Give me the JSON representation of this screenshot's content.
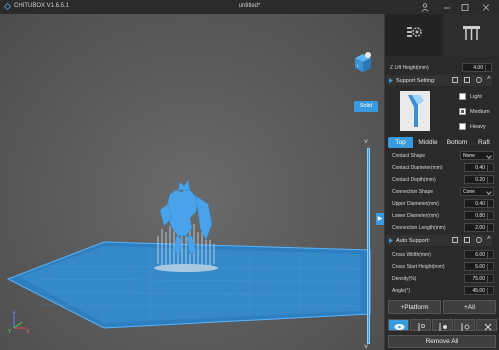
{
  "titlebar": {
    "app_name": "CHITUBOX V1.6.5.1",
    "doc_title": "untitled*",
    "user_icon": "user-icon",
    "minimize_icon": "minimize-icon",
    "maximize_icon": "maximize-icon",
    "close_icon": "close-icon"
  },
  "viewport": {
    "render_mode": "Solid",
    "axis_x": "X",
    "axis_y": "Y",
    "axis_z": "Z"
  },
  "panel": {
    "tabs": [
      {
        "label": "print-settings-tab",
        "icon": "gear-icon"
      },
      {
        "label": "support-tab",
        "icon": "support-icon"
      }
    ],
    "z_lift": {
      "label": "Z Lift Height(mm)",
      "value": "4.00"
    },
    "support_setting": {
      "label": "Support Setting:"
    },
    "density_options": [
      {
        "label": "Light",
        "checked": false
      },
      {
        "label": "Medium",
        "checked": true
      },
      {
        "label": "Heavy",
        "checked": false
      }
    ],
    "sub_tabs": [
      "Top",
      "Middle",
      "Bottom",
      "Raft"
    ],
    "active_sub_tab": "Top",
    "top_fields": [
      {
        "label": "Contact Shape",
        "value": "None",
        "type": "dropdown"
      },
      {
        "label": "Contact Diameter(mm)",
        "value": "0.40"
      },
      {
        "label": "Contact Depth(mm)",
        "value": "0.20"
      },
      {
        "label": "Connection Shape",
        "value": "Cone",
        "type": "dropdown"
      },
      {
        "label": "Upper Diameter(mm)",
        "value": "0.40"
      },
      {
        "label": "Lower Diameter(mm)",
        "value": "0.80"
      },
      {
        "label": "Connection Length(mm)",
        "value": "2.00"
      }
    ],
    "auto_support": {
      "label": "Auto Support:"
    },
    "auto_fields": [
      {
        "label": "Cross Width(mm)",
        "value": "6.00"
      },
      {
        "label": "Cross Start Height(mm)",
        "value": "5.00"
      },
      {
        "label": "Density(%)",
        "value": "75.00"
      },
      {
        "label": "Angle(°)",
        "value": "45.00"
      }
    ],
    "platform_button": "+Platform",
    "all_button": "+All",
    "remove_all": "Remove All"
  },
  "colors": {
    "accent": "#3a9ae0",
    "platform": "#2f8fd6",
    "model": "#4aa3ea",
    "panel_bg": "#2a2a2a"
  }
}
